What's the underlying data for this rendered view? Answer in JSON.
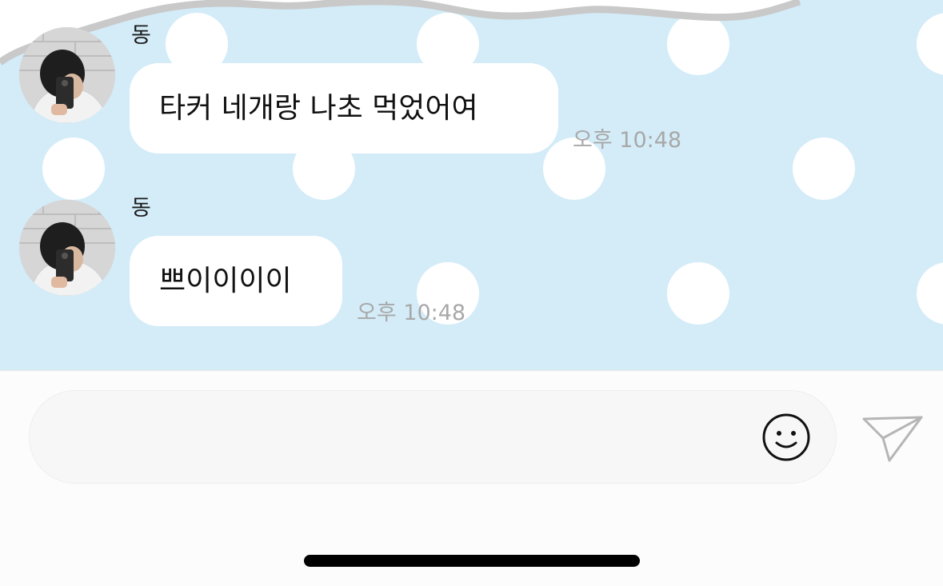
{
  "chat": {
    "messages": [
      {
        "sender": "동",
        "text": "타커 네개랑 나초 먹었어여",
        "time": "오후 10:48"
      },
      {
        "sender": "동",
        "text": "쁘이이이이",
        "time": "오후 10:48"
      }
    ]
  },
  "composer": {
    "message_input_value": "",
    "emoji_icon": "smiley-face-icon",
    "send_icon": "paper-plane-icon"
  },
  "colors": {
    "chat_background": "#d3ecf8",
    "polka_dot": "#ffffff",
    "bubble": "#ffffff",
    "timestamp": "#a8a8a8",
    "input_background": "#f7f7f7"
  }
}
